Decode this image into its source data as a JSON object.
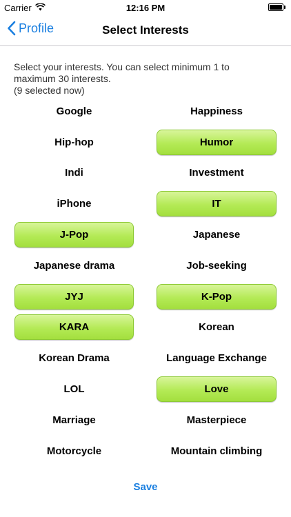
{
  "status_bar": {
    "carrier": "Carrier",
    "time": "12:16 PM",
    "wifi_icon": "wifi-icon",
    "battery_icon": "battery-icon",
    "battery_level": 1.0
  },
  "nav": {
    "back_label": "Profile",
    "title": "Select Interests",
    "back_icon": "chevron-left-icon"
  },
  "instructions": {
    "line1": "Select your interests. You can select minimum 1 to",
    "line2": "maximum 30 interests.",
    "line3": "(9 selected now)"
  },
  "interests": [
    {
      "label": "Google",
      "selected": false
    },
    {
      "label": "Happiness",
      "selected": false
    },
    {
      "label": "Hip-hop",
      "selected": false
    },
    {
      "label": "Humor",
      "selected": true
    },
    {
      "label": "Indi",
      "selected": false
    },
    {
      "label": "Investment",
      "selected": false
    },
    {
      "label": "iPhone",
      "selected": false
    },
    {
      "label": "IT",
      "selected": true
    },
    {
      "label": "J-Pop",
      "selected": true
    },
    {
      "label": "Japanese",
      "selected": false
    },
    {
      "label": "Japanese drama",
      "selected": false
    },
    {
      "label": "Job-seeking",
      "selected": false
    },
    {
      "label": "JYJ",
      "selected": true
    },
    {
      "label": "K-Pop",
      "selected": true
    },
    {
      "label": "KARA",
      "selected": true
    },
    {
      "label": "Korean",
      "selected": false
    },
    {
      "label": "Korean Drama",
      "selected": false
    },
    {
      "label": "Language Exchange",
      "selected": false
    },
    {
      "label": "LOL",
      "selected": false
    },
    {
      "label": "Love",
      "selected": true
    },
    {
      "label": "Marriage",
      "selected": false
    },
    {
      "label": "Masterpiece",
      "selected": false
    },
    {
      "label": "Motorcycle",
      "selected": false
    },
    {
      "label": "Mountain climbing",
      "selected": false
    }
  ],
  "save_label": "Save",
  "colors": {
    "accent": "#1a7fe0",
    "selected_green": "#b4ea56"
  }
}
